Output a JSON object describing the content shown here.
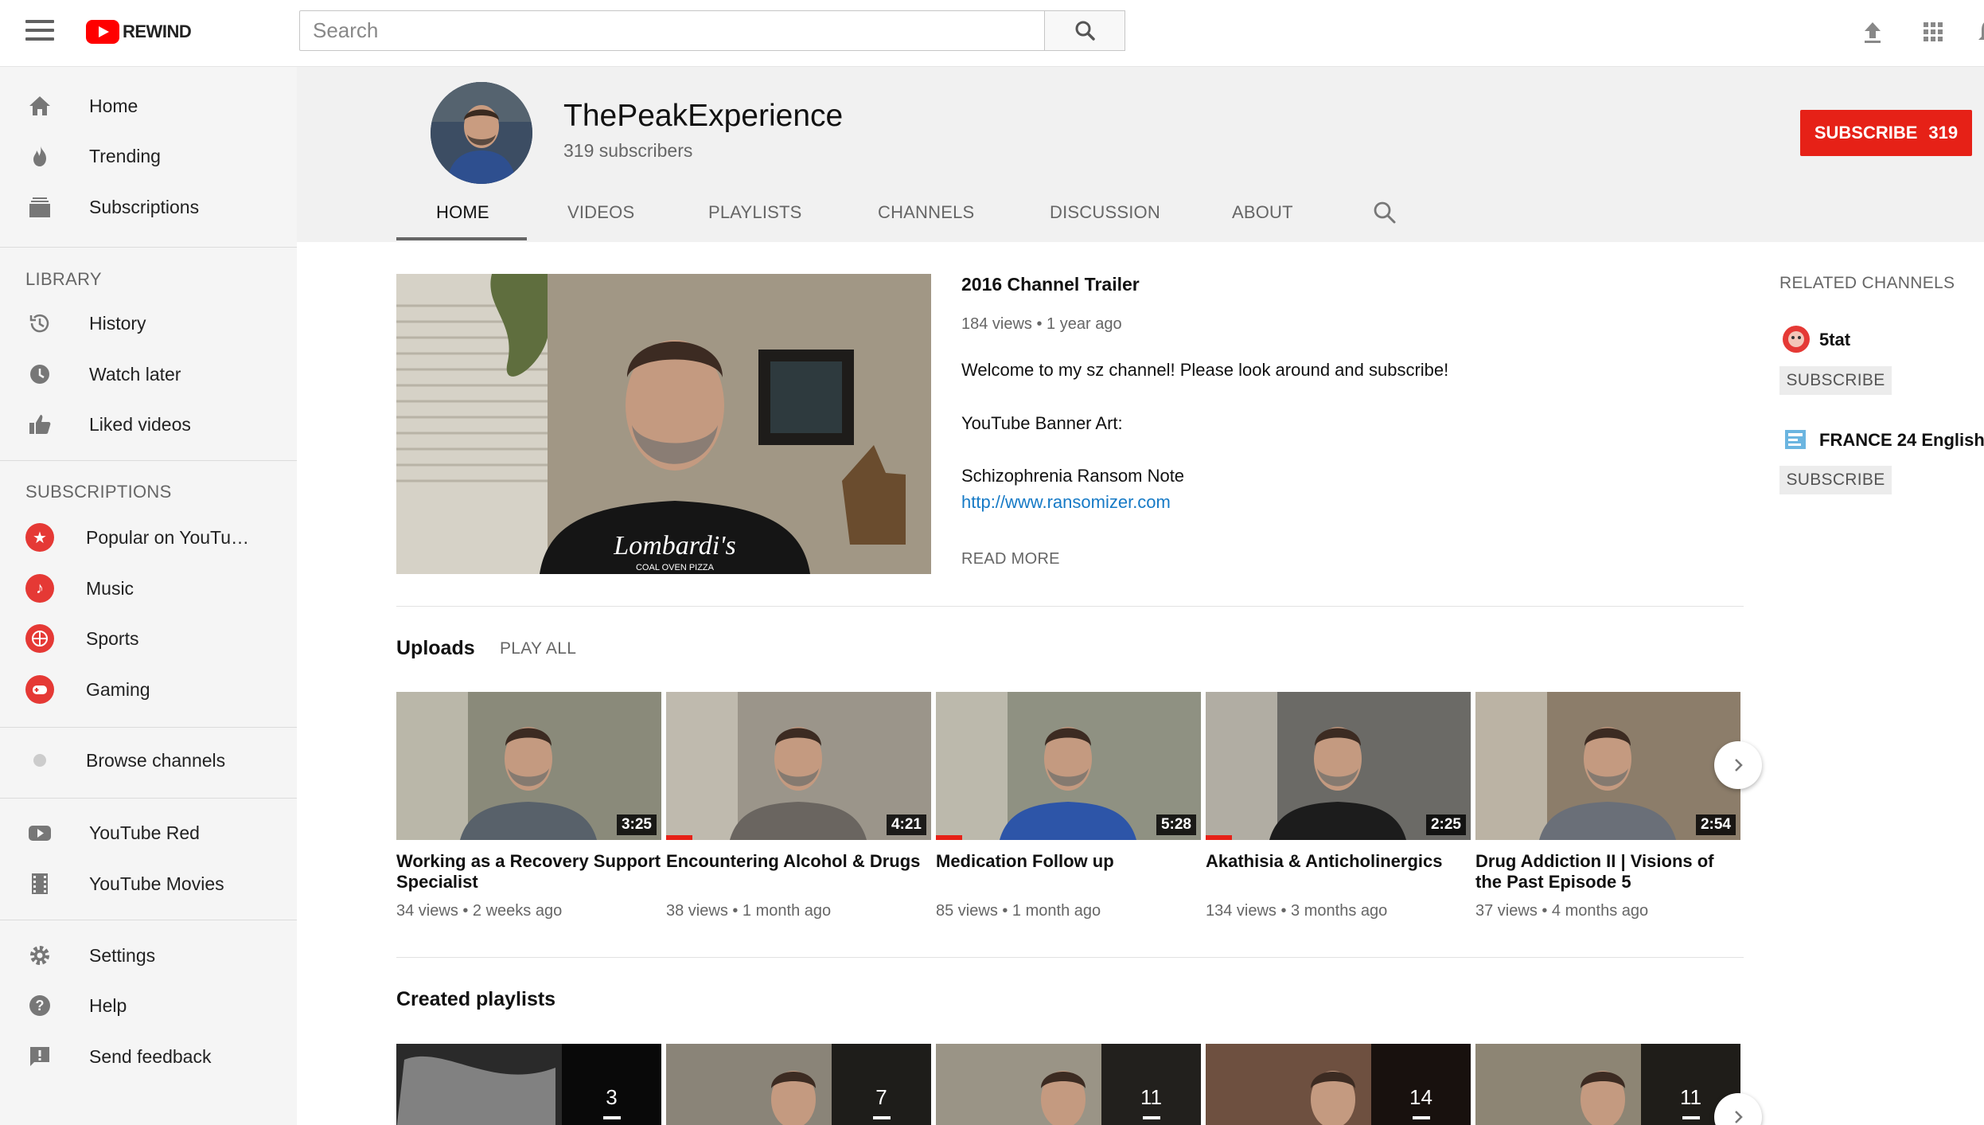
{
  "header": {
    "logo_text": "REWIND",
    "search_placeholder": "Search"
  },
  "sidebar": {
    "main": [
      {
        "label": "Home",
        "icon": "home-icon"
      },
      {
        "label": "Trending",
        "icon": "flame-icon"
      },
      {
        "label": "Subscriptions",
        "icon": "subscriptions-icon"
      }
    ],
    "library_heading": "LIBRARY",
    "library": [
      {
        "label": "History",
        "icon": "history-icon"
      },
      {
        "label": "Watch later",
        "icon": "clock-icon"
      },
      {
        "label": "Liked videos",
        "icon": "thumbs-up-icon"
      }
    ],
    "subscriptions_heading": "SUBSCRIPTIONS",
    "subscriptions": [
      {
        "label": "Popular on YouTu…",
        "icon": "star-icon"
      },
      {
        "label": "Music",
        "icon": "music-note-icon"
      },
      {
        "label": "Sports",
        "icon": "basketball-icon"
      },
      {
        "label": "Gaming",
        "icon": "gamepad-icon"
      }
    ],
    "browse": {
      "label": "Browse channels",
      "icon": "browse-icon"
    },
    "youtube": [
      {
        "label": "YouTube Red",
        "icon": "youtube-red-icon"
      },
      {
        "label": "YouTube Movies",
        "icon": "film-icon"
      }
    ],
    "footer": [
      {
        "label": "Settings",
        "icon": "gear-icon"
      },
      {
        "label": "Help",
        "icon": "help-icon"
      },
      {
        "label": "Send feedback",
        "icon": "feedback-icon"
      }
    ]
  },
  "channel": {
    "name": "ThePeakExperience",
    "subscribers": "319 subscribers",
    "subscribe_label": "SUBSCRIBE",
    "subscribe_count": "319",
    "tabs": [
      "HOME",
      "VIDEOS",
      "PLAYLISTS",
      "CHANNELS",
      "DISCUSSION",
      "ABOUT"
    ],
    "active_tab": "HOME"
  },
  "trailer": {
    "title": "2016 Channel Trailer",
    "meta": "184 views • 1 year ago",
    "desc1": "Welcome to my sz channel! Please look around and subscribe!",
    "desc2": "YouTube Banner Art:",
    "desc3": "Schizophrenia Ransom Note",
    "link": "http://www.ransomizer.com",
    "read_more": "READ MORE",
    "shirt_text": "Lombardi's",
    "shirt_subtext": "COAL OVEN PIZZA"
  },
  "related": {
    "heading": "RELATED CHANNELS",
    "channels": [
      {
        "name": "5tat",
        "subscribe": "SUBSCRIBE"
      },
      {
        "name": "FRANCE 24 English",
        "subscribe": "SUBSCRIBE"
      }
    ]
  },
  "uploads": {
    "title": "Uploads",
    "play_all": "PLAY ALL",
    "videos": [
      {
        "title": "Working as a Recovery Support Specialist",
        "meta": "34 views • 2 weeks ago",
        "duration": "3:25",
        "watched": 0
      },
      {
        "title": "Encountering Alcohol & Drugs",
        "meta": "38 views • 1 month ago",
        "duration": "4:21",
        "watched": 0.1
      },
      {
        "title": "Medication Follow up",
        "meta": "85 views • 1 month ago",
        "duration": "5:28",
        "watched": 0.1
      },
      {
        "title": "Akathisia & Anticholinergics",
        "meta": "134 views • 3 months ago",
        "duration": "2:25",
        "watched": 0.1
      },
      {
        "title": "Drug Addiction II | Visions of the Past Episode 5",
        "meta": "37 views • 4 months ago",
        "duration": "2:54",
        "watched": 0
      }
    ]
  },
  "playlists": {
    "title": "Created playlists",
    "items": [
      {
        "count": "3"
      },
      {
        "count": "7"
      },
      {
        "count": "11"
      },
      {
        "count": "14"
      },
      {
        "count": "11"
      }
    ]
  },
  "colors": {
    "accent": "#e62117",
    "link": "#167ac6",
    "sidebar_bg": "#f5f5f5",
    "header_bg": "#f1f1f1"
  }
}
